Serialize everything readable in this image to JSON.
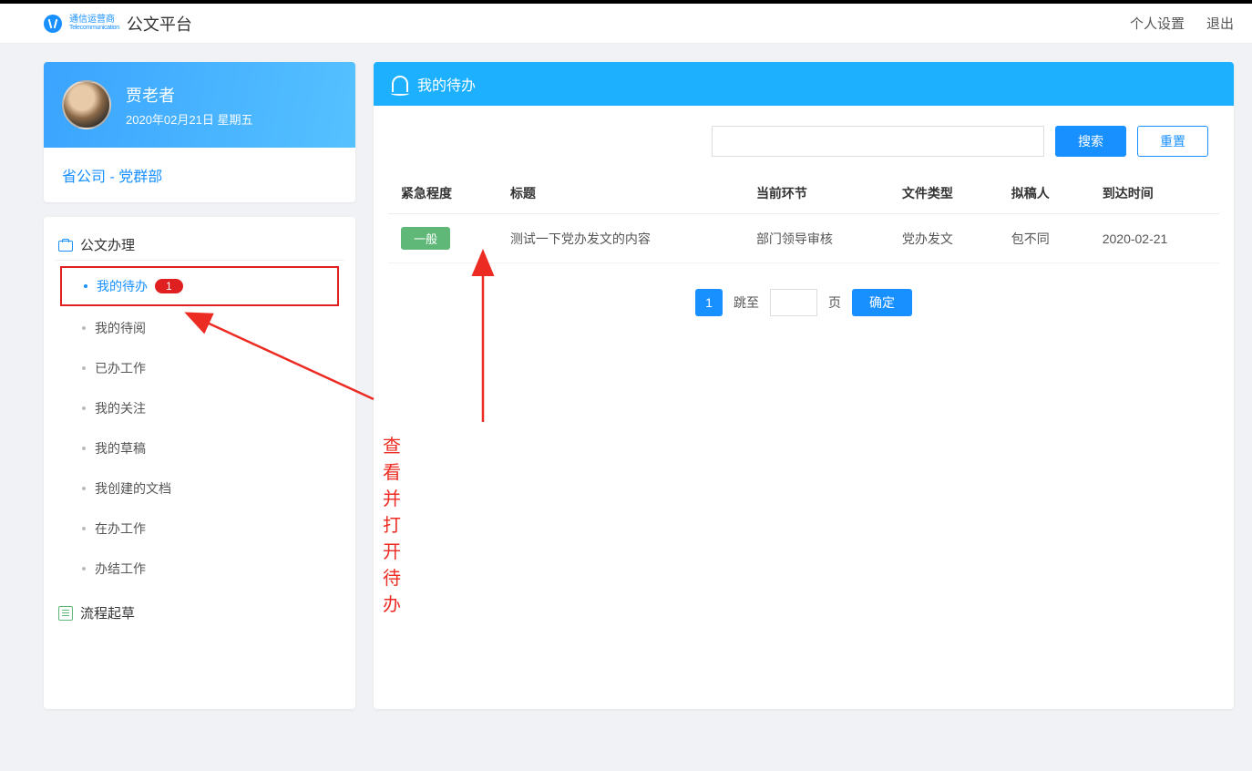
{
  "header": {
    "brand_line1": "通信运营商",
    "brand_line2": "Telecommunication",
    "app_title": "公文平台",
    "settings": "个人设置",
    "logout": "退出"
  },
  "user": {
    "name": "贾老者",
    "date": "2020年02月21日 星期五",
    "org": "省公司 - 党群部"
  },
  "nav": {
    "section1": "公文办理",
    "section2": "流程起草",
    "items": [
      {
        "label": "我的待办",
        "badge": "1",
        "active": true,
        "highlighted": true
      },
      {
        "label": "我的待阅"
      },
      {
        "label": "已办工作"
      },
      {
        "label": "我的关注"
      },
      {
        "label": "我的草稿"
      },
      {
        "label": "我创建的文档"
      },
      {
        "label": "在办工作"
      },
      {
        "label": "办结工作"
      }
    ]
  },
  "panel": {
    "title": "我的待办",
    "search_placeholder": "",
    "search_btn": "搜索",
    "reset_btn": "重置"
  },
  "table": {
    "headers": {
      "urgency": "紧急程度",
      "title": "标题",
      "step": "当前环节",
      "type": "文件类型",
      "drafter": "拟稿人",
      "arrived": "到达时间"
    },
    "rows": [
      {
        "urgency": "一般",
        "title": "测试一下党办发文的内容",
        "step": "部门领导审核",
        "type": "党办发文",
        "drafter": "包不同",
        "arrived": "2020-02-21"
      }
    ]
  },
  "pager": {
    "current": "1",
    "jump_label": "跳至",
    "suffix": "页",
    "confirm": "确定"
  },
  "annotation": {
    "text": "查看并打开待办"
  }
}
